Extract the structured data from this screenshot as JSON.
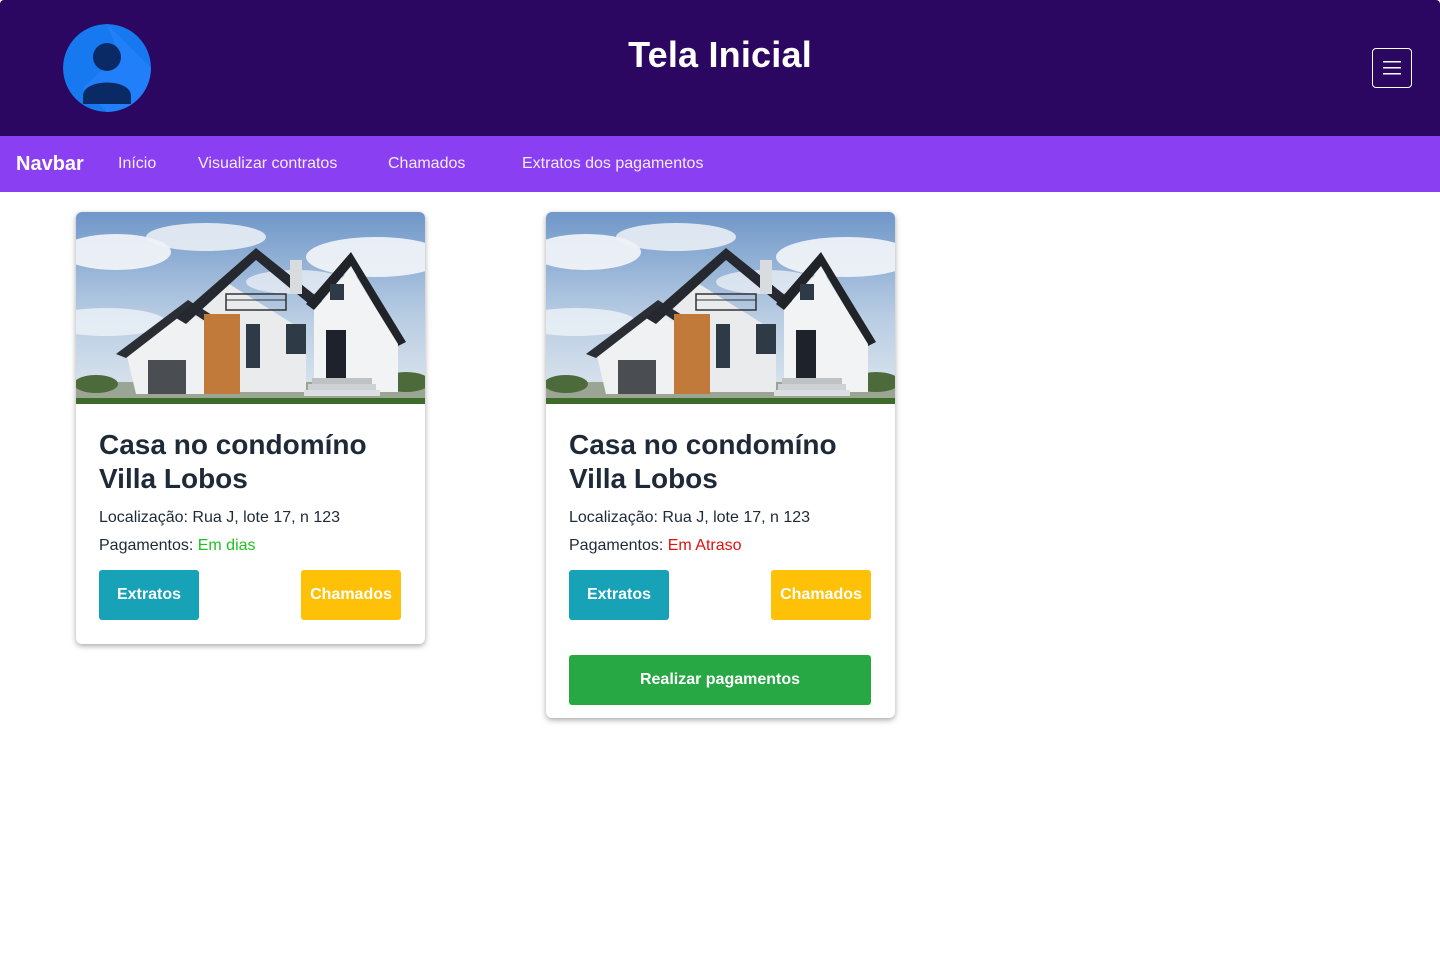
{
  "header": {
    "title": "Tela Inicial",
    "avatar_icon": "user-avatar-icon",
    "menu_icon": "hamburger-menu-icon",
    "background": "#2b0762"
  },
  "navbar": {
    "brand": "Navbar",
    "links": [
      "Início",
      "Visualizar contratos",
      "Chamados",
      "Extratos dos pagamentos"
    ],
    "background": "#8a3ff2"
  },
  "cards": [
    {
      "image": "house-photo",
      "title": "Casa no condomíno Villa Lobos",
      "location_label": "Localização:",
      "location_value": "Rua J, lote 17, n 123",
      "payments_label": "Pagamentos:",
      "payments_status": "Em dias",
      "payments_status_color": "#1fc21f",
      "extratos_label": "Extratos",
      "chamados_label": "Chamados"
    },
    {
      "image": "house-photo",
      "title": "Casa no condomíno Villa Lobos",
      "location_label": "Localização:",
      "location_value": "Rua J, lote 17, n 123",
      "payments_label": "Pagamentos:",
      "payments_status": "Em Atraso",
      "payments_status_color": "#e01010",
      "extratos_label": "Extratos",
      "chamados_label": "Chamados",
      "pay_button_label": "Realizar pagamentos"
    }
  ],
  "colors": {
    "extratos_button": "#17a2b8",
    "chamados_button": "#ffc107",
    "pay_button": "#28a745"
  }
}
